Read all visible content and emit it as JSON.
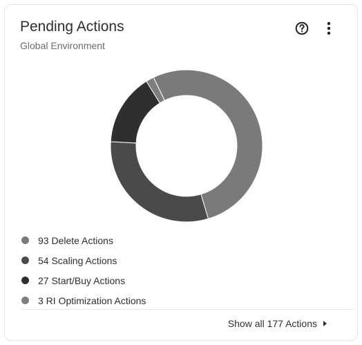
{
  "card": {
    "title": "Pending Actions",
    "subtitle": "Global Environment",
    "help_icon": "question-circle-icon",
    "menu_icon": "kebab-menu-icon"
  },
  "chart_data": {
    "type": "pie",
    "donut": true,
    "title": "",
    "series": [
      {
        "name": "93 Delete Actions",
        "value": 93,
        "color": "#7a7a7a"
      },
      {
        "name": "54 Scaling Actions",
        "value": 54,
        "color": "#4a4a4a"
      },
      {
        "name": "27 Start/Buy Actions",
        "value": 27,
        "color": "#2f2f2f"
      },
      {
        "name": "3 RI Optimization Actions",
        "value": 3,
        "color": "#7e7e7e"
      }
    ]
  },
  "legend": [
    {
      "label": "93 Delete Actions",
      "color": "#7a7a7a"
    },
    {
      "label": "54 Scaling Actions",
      "color": "#4a4a4a"
    },
    {
      "label": "27 Start/Buy Actions",
      "color": "#2f2f2f"
    },
    {
      "label": "3 RI Optimization Actions",
      "color": "#7e7e7e"
    }
  ],
  "footer": {
    "link_label": "Show all 177 Actions",
    "link_icon": "caret-right-icon"
  }
}
